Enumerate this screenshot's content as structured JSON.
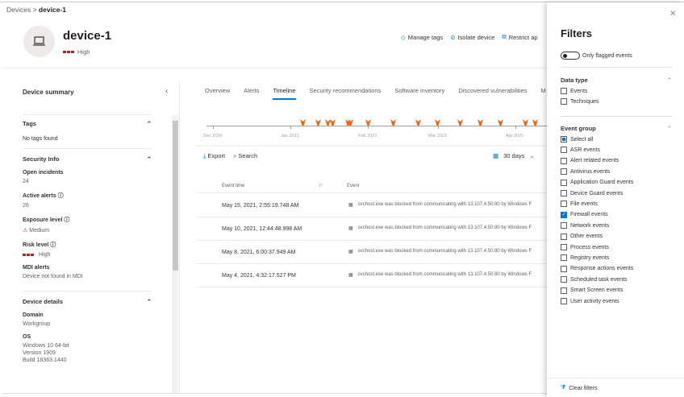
{
  "breadcrumb": {
    "root": "Devices",
    "current": "device-1"
  },
  "device": {
    "name": "device-1",
    "risk": "High",
    "risk_color": "#a4262c"
  },
  "actions": [
    {
      "label": "Manage tags",
      "icon": "tag-icon"
    },
    {
      "label": "Isolate device",
      "icon": "block-icon"
    },
    {
      "label": "Restrict ap",
      "icon": "restrict-icon"
    }
  ],
  "summary": {
    "title": "Device summary",
    "tags": {
      "header": "Tags",
      "value": "No tags found"
    },
    "security": {
      "header": "Security Info",
      "open_incidents_label": "Open incidents",
      "open_incidents": "24",
      "active_alerts_label": "Active alerts",
      "active_alerts": "26",
      "exposure_label": "Exposure level",
      "exposure": "Medium",
      "risk_label": "Risk level",
      "risk": "High",
      "mdi_label": "MDI alerts",
      "mdi": "Device not found in MDI"
    },
    "details": {
      "header": "Device details",
      "domain_label": "Domain",
      "domain": "Workgroup",
      "os_label": "OS",
      "os": [
        "Windows 10 64-bit",
        "Version 1909",
        "Build 18363.1440"
      ]
    }
  },
  "tabs": [
    {
      "label": "Overview"
    },
    {
      "label": "Alerts"
    },
    {
      "label": "Timeline",
      "active": true
    },
    {
      "label": "Security recommendations"
    },
    {
      "label": "Software inventory"
    },
    {
      "label": "Discovered vulnerabilities"
    },
    {
      "label": "M"
    }
  ],
  "timeline": {
    "axis_labels": [
      {
        "label": "Dec 2020",
        "date": "2020-12-01"
      },
      {
        "label": "Jan 2021",
        "date": "2021-01-01"
      },
      {
        "label": "Feb 2021",
        "date": "2021-02-01"
      },
      {
        "label": "Mar 2021",
        "date": "2021-03-01"
      },
      {
        "label": "Apr 2021",
        "date": "2021-04-01"
      }
    ],
    "markers": [
      "2021-01-06",
      "2021-01-12",
      "2021-01-16",
      "2021-01-18",
      "2021-01-24",
      "2021-01-25",
      "2021-02-01",
      "2021-02-11",
      "2021-02-21",
      "2021-03-01",
      "2021-03-10",
      "2021-03-18",
      "2021-03-26",
      "2021-04-05",
      "2021-04-09"
    ],
    "marker_color": "#f7630c"
  },
  "toolbar": {
    "export": "Export",
    "search": "Search",
    "range": "30 days"
  },
  "table": {
    "headers": {
      "time": "Event time",
      "event": "Event"
    },
    "rows": [
      {
        "time": "May 15, 2021, 2:55:19.748 AM",
        "event": "svchost.exe was blocked from communicating with 13.107.4.50:80 by Windows F"
      },
      {
        "time": "May 10, 2021, 12:44:48.998 AM",
        "event": "svchost.exe was blocked from communicating with 13.107.4.50:80 by Windows F"
      },
      {
        "time": "May 8, 2021, 6:00:37.949 AM",
        "event": "svchost.exe was blocked from communicating with 13.107.4.50:80 by Windows F"
      },
      {
        "time": "May 4, 2021, 4:32:17.527 PM",
        "event": "svchost.exe was blocked from communicating with 13.107.4.50:80 by Windows F"
      }
    ]
  },
  "filters": {
    "title": "Filters",
    "toggle": "Only flagged events",
    "toggle_on": false,
    "data_type": {
      "header": "Data type",
      "items": [
        {
          "label": "Events",
          "state": "off"
        },
        {
          "label": "Techniques",
          "state": "off"
        }
      ]
    },
    "event_group": {
      "header": "Event group",
      "items": [
        {
          "label": "Select all",
          "state": "indeterminate"
        },
        {
          "label": "ASR events",
          "state": "off"
        },
        {
          "label": "Alert related events",
          "state": "off"
        },
        {
          "label": "Antivirus events",
          "state": "off"
        },
        {
          "label": "Application Guard events",
          "state": "off"
        },
        {
          "label": "Device Guard events",
          "state": "off"
        },
        {
          "label": "File events",
          "state": "off"
        },
        {
          "label": "Firewall events",
          "state": "on"
        },
        {
          "label": "Network events",
          "state": "off"
        },
        {
          "label": "Other events",
          "state": "off"
        },
        {
          "label": "Process events",
          "state": "off"
        },
        {
          "label": "Registry events",
          "state": "off"
        },
        {
          "label": "Response actions events",
          "state": "off"
        },
        {
          "label": "Scheduled task events",
          "state": "off"
        },
        {
          "label": "Smart Screen events",
          "state": "off"
        },
        {
          "label": "User activity events",
          "state": "off"
        }
      ]
    },
    "clear": "Clear filters"
  }
}
